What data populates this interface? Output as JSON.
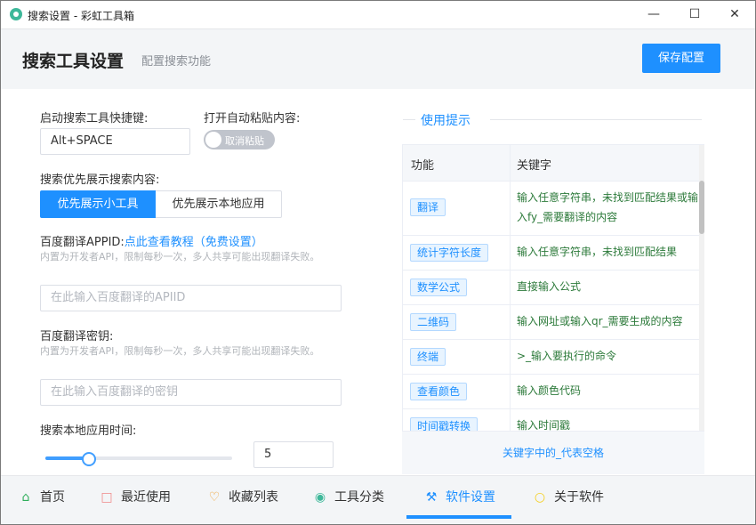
{
  "window": {
    "title": "搜索设置 - 彩虹工具箱"
  },
  "header": {
    "title": "搜索工具设置",
    "subtitle": "配置搜索功能",
    "save_label": "保存配置"
  },
  "hotkey": {
    "label": "启动搜索工具快捷键:",
    "value": "Alt+SPACE"
  },
  "autopaste": {
    "label": "打开自动粘贴内容:",
    "toggle_text": "取消粘贴"
  },
  "priority": {
    "label": "搜索优先展示搜索内容:",
    "option_tools": "优先展示小工具",
    "option_local": "优先展示本地应用"
  },
  "appid": {
    "label": "百度翻译APPID:",
    "link": "点此查看教程（免费设置）",
    "hint": "内置为开发者API，限制每秒一次，多人共享可能出现翻译失败。",
    "placeholder": "在此输入百度翻译的APIID"
  },
  "secret": {
    "label": "百度翻译密钥:",
    "hint": "内置为开发者API，限制每秒一次，多人共享可能出现翻译失败。",
    "placeholder": "在此输入百度翻译的密钥"
  },
  "local_time": {
    "label": "搜索本地应用时间:",
    "value": "5",
    "slider_fraction": 0.23
  },
  "tips": {
    "title": "使用提示",
    "headers": {
      "function": "功能",
      "keyword": "关键字"
    },
    "rows": [
      {
        "function": "翻译",
        "keyword": "输入任意字符串，未找到匹配结果或输入fy_需要翻译的内容"
      },
      {
        "function": "统计字符长度",
        "keyword": "输入任意字符串，未找到匹配结果"
      },
      {
        "function": "数学公式",
        "keyword": "直接输入公式"
      },
      {
        "function": "二维码",
        "keyword": "输入网址或输入qr_需要生成的内容"
      },
      {
        "function": "终端",
        "keyword": ">_输入要执行的命令"
      },
      {
        "function": "查看颜色",
        "keyword": "输入颜色代码"
      },
      {
        "function": "时间戳转换",
        "keyword": "输入时间戳"
      }
    ],
    "footer": "关键字中的_代表空格"
  },
  "nav": {
    "items": [
      {
        "label": "首页",
        "icon": "home-icon"
      },
      {
        "label": "最近使用",
        "icon": "folder-icon"
      },
      {
        "label": "收藏列表",
        "icon": "heart-icon"
      },
      {
        "label": "工具分类",
        "icon": "category-icon"
      },
      {
        "label": "软件设置",
        "icon": "wrench-icon"
      },
      {
        "label": "关于软件",
        "icon": "bulb-icon"
      }
    ],
    "active_index": 4
  },
  "colors": {
    "accent": "#1e90ff",
    "keyword_text": "#2c7a3a",
    "header_bg": "#f3f5f7"
  }
}
